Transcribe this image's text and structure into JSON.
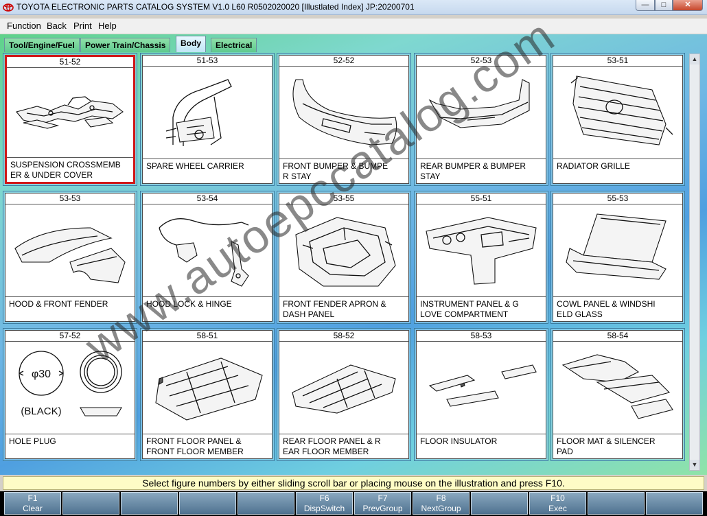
{
  "window": {
    "title": "TOYOTA ELECTRONIC PARTS CATALOG SYSTEM V1.0 L60 R0502020020 [Illustlated Index] JP:20200701",
    "min_label": "—",
    "max_label": "□",
    "close_label": "✕"
  },
  "menu": [
    "Function",
    "Back",
    "Print",
    "Help"
  ],
  "tabs": [
    "Tool/Engine/Fuel",
    "Power Train/Chassis",
    "Body",
    "Electrical"
  ],
  "active_tab": "Body",
  "figures": [
    {
      "no": "51-52",
      "name": "SUSPENSION CROSSMEMB\nER & UNDER COVER",
      "icon": "crossmember-illustration"
    },
    {
      "no": "51-53",
      "name": "SPARE WHEEL CARRIER",
      "icon": "spare-wheel-carrier-illustration"
    },
    {
      "no": "52-52",
      "name": "FRONT BUMPER & BUMPE\nR STAY",
      "icon": "front-bumper-illustration"
    },
    {
      "no": "52-53",
      "name": "REAR BUMPER & BUMPER\n STAY",
      "icon": "rear-bumper-illustration"
    },
    {
      "no": "53-51",
      "name": "RADIATOR GRILLE",
      "icon": "radiator-grille-illustration"
    },
    {
      "no": "53-53",
      "name": "HOOD & FRONT FENDER",
      "icon": "hood-fender-illustration"
    },
    {
      "no": "53-54",
      "name": "HOOD LOCK & HINGE",
      "icon": "hood-lock-illustration"
    },
    {
      "no": "53-55",
      "name": "FRONT FENDER APRON &\n DASH PANEL",
      "icon": "fender-apron-illustration"
    },
    {
      "no": "55-51",
      "name": "INSTRUMENT PANEL & G\nLOVE COMPARTMENT",
      "icon": "instrument-panel-illustration"
    },
    {
      "no": "55-53",
      "name": "COWL PANEL & WINDSHI\nELD GLASS",
      "icon": "cowl-windshield-illustration"
    },
    {
      "no": "57-52",
      "name": "HOLE PLUG",
      "icon": "hole-plug-illustration"
    },
    {
      "no": "58-51",
      "name": "FRONT FLOOR PANEL &\nFRONT FLOOR MEMBER",
      "icon": "front-floor-illustration"
    },
    {
      "no": "58-52",
      "name": "REAR FLOOR PANEL & R\nEAR FLOOR MEMBER",
      "icon": "rear-floor-illustration"
    },
    {
      "no": "58-53",
      "name": "FLOOR INSULATOR",
      "icon": "floor-insulator-illustration"
    },
    {
      "no": "58-54",
      "name": "FLOOR MAT & SILENCER\n PAD",
      "icon": "floor-mat-illustration"
    }
  ],
  "selected_figure": "51-52",
  "hole_plug": {
    "diameter_label": "φ30",
    "color_label": "(BLACK)"
  },
  "status_text": "Select figure numbers by either sliding scroll bar or placing mouse on the illustration and press F10.",
  "fkeys": [
    {
      "key": "F1",
      "label": "Clear"
    },
    {
      "key": "",
      "label": ""
    },
    {
      "key": "",
      "label": ""
    },
    {
      "key": "",
      "label": ""
    },
    {
      "key": "",
      "label": ""
    },
    {
      "key": "F6",
      "label": "DispSwitch"
    },
    {
      "key": "F7",
      "label": "PrevGroup"
    },
    {
      "key": "F8",
      "label": "NextGroup"
    },
    {
      "key": "",
      "label": ""
    },
    {
      "key": "F10",
      "label": "Exec"
    },
    {
      "key": "",
      "label": ""
    },
    {
      "key": "",
      "label": ""
    }
  ],
  "watermark": "www.autoepccatalog.com",
  "colors": {
    "selected_border": "#d01818",
    "status_bg": "#fefcc6",
    "fkey_bg": "#4f7290"
  }
}
